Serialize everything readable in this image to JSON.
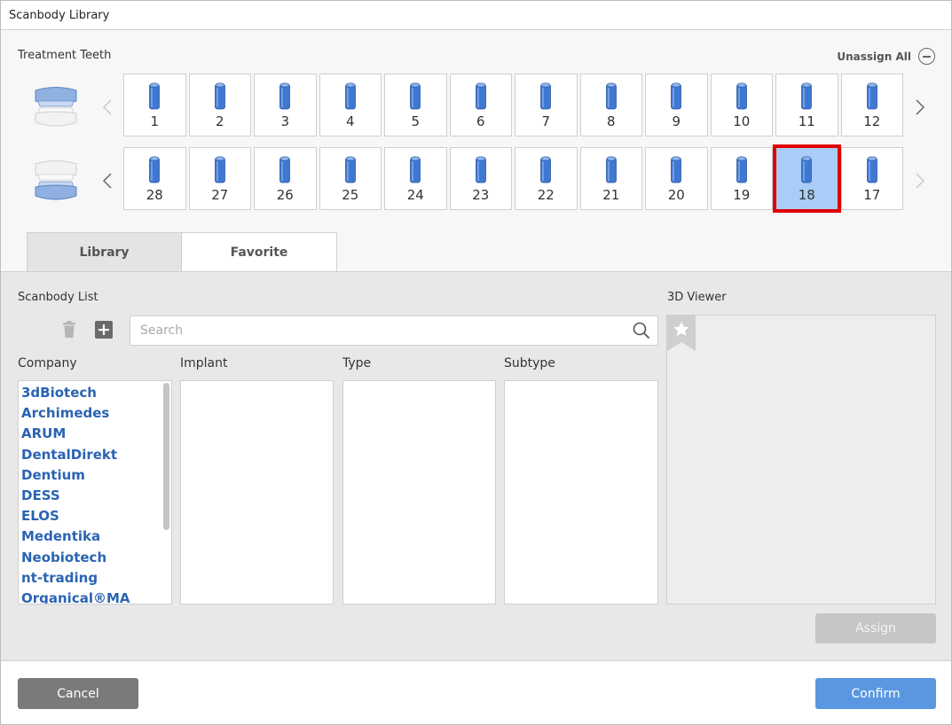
{
  "window": {
    "title": "Scanbody Library"
  },
  "treatment": {
    "label": "Treatment Teeth",
    "unassign_all": "Unassign All",
    "upper_teeth": [
      "1",
      "2",
      "3",
      "4",
      "5",
      "6",
      "7",
      "8",
      "9",
      "10",
      "11",
      "12"
    ],
    "lower_teeth": [
      "28",
      "27",
      "26",
      "25",
      "24",
      "23",
      "22",
      "21",
      "20",
      "19",
      "18",
      "17"
    ],
    "selected_tooth": "18"
  },
  "tabs": {
    "library": "Library",
    "favorite": "Favorite",
    "active": "library"
  },
  "scanbody": {
    "list_label": "Scanbody List",
    "search_placeholder": "Search",
    "search_value": "",
    "columns": {
      "company": "Company",
      "implant": "Implant",
      "type": "Type",
      "subtype": "Subtype"
    },
    "companies": [
      "3dBiotech",
      "Archimedes",
      "ARUM",
      "DentalDirekt",
      "Dentium",
      "DESS",
      "ELOS",
      "Medentika",
      "Neobiotech",
      "nt-trading",
      "Organical®MA"
    ]
  },
  "viewer": {
    "label": "3D Viewer"
  },
  "buttons": {
    "assign": "Assign",
    "cancel": "Cancel",
    "confirm": "Confirm"
  },
  "colors": {
    "accent": "#5a97e0",
    "link": "#2a63b4",
    "selected_fill": "#a9cdf6",
    "selected_border": "#e00000",
    "cylinder": "#3f78d1"
  },
  "icons": [
    "jaw-upper-icon",
    "jaw-lower-icon",
    "chevron-left-icon",
    "chevron-right-icon",
    "minus-circle-icon",
    "trash-icon",
    "plus-square-icon",
    "search-icon",
    "star-bookmark-icon",
    "scanbody-cylinder-icon"
  ]
}
